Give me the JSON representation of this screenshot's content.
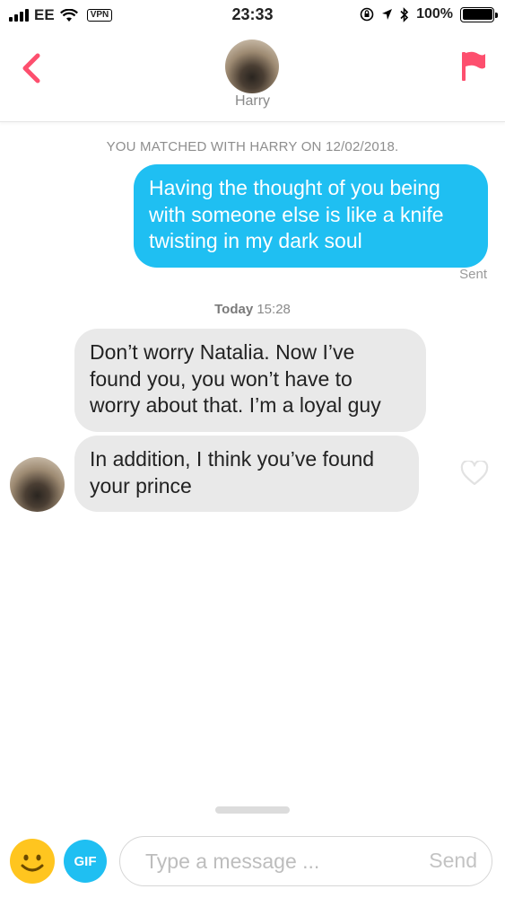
{
  "status_bar": {
    "carrier": "EE",
    "vpn": "VPN",
    "time": "23:33",
    "battery": "100%"
  },
  "header": {
    "contact_name": "Harry"
  },
  "chat": {
    "match_note": "YOU MATCHED WITH HARRY ON 12/02/2018.",
    "outgoing": {
      "text": "Having the thought of you being with someone else is like a knife twisting in my dark soul",
      "status": "Sent"
    },
    "timestamp": {
      "day": "Today",
      "time": "15:28"
    },
    "incoming": [
      {
        "text": "Don’t worry Natalia. Now I’ve found you, you won’t have to worry about that. I’m a loyal guy"
      },
      {
        "text": "In addition, I think you’ve found your prince"
      }
    ]
  },
  "composer": {
    "gif_label": "GIF",
    "placeholder": "Type a message ...",
    "send_label": "Send"
  },
  "colors": {
    "accent_blue": "#1fbff2",
    "brand_pink": "#fd4f6e",
    "incoming_bubble": "#e9e9e9"
  },
  "icons": [
    "wifi-icon",
    "location-icon",
    "bluetooth-icon",
    "back-chevron-icon",
    "flag-icon",
    "heart-icon",
    "smiley-icon"
  ]
}
